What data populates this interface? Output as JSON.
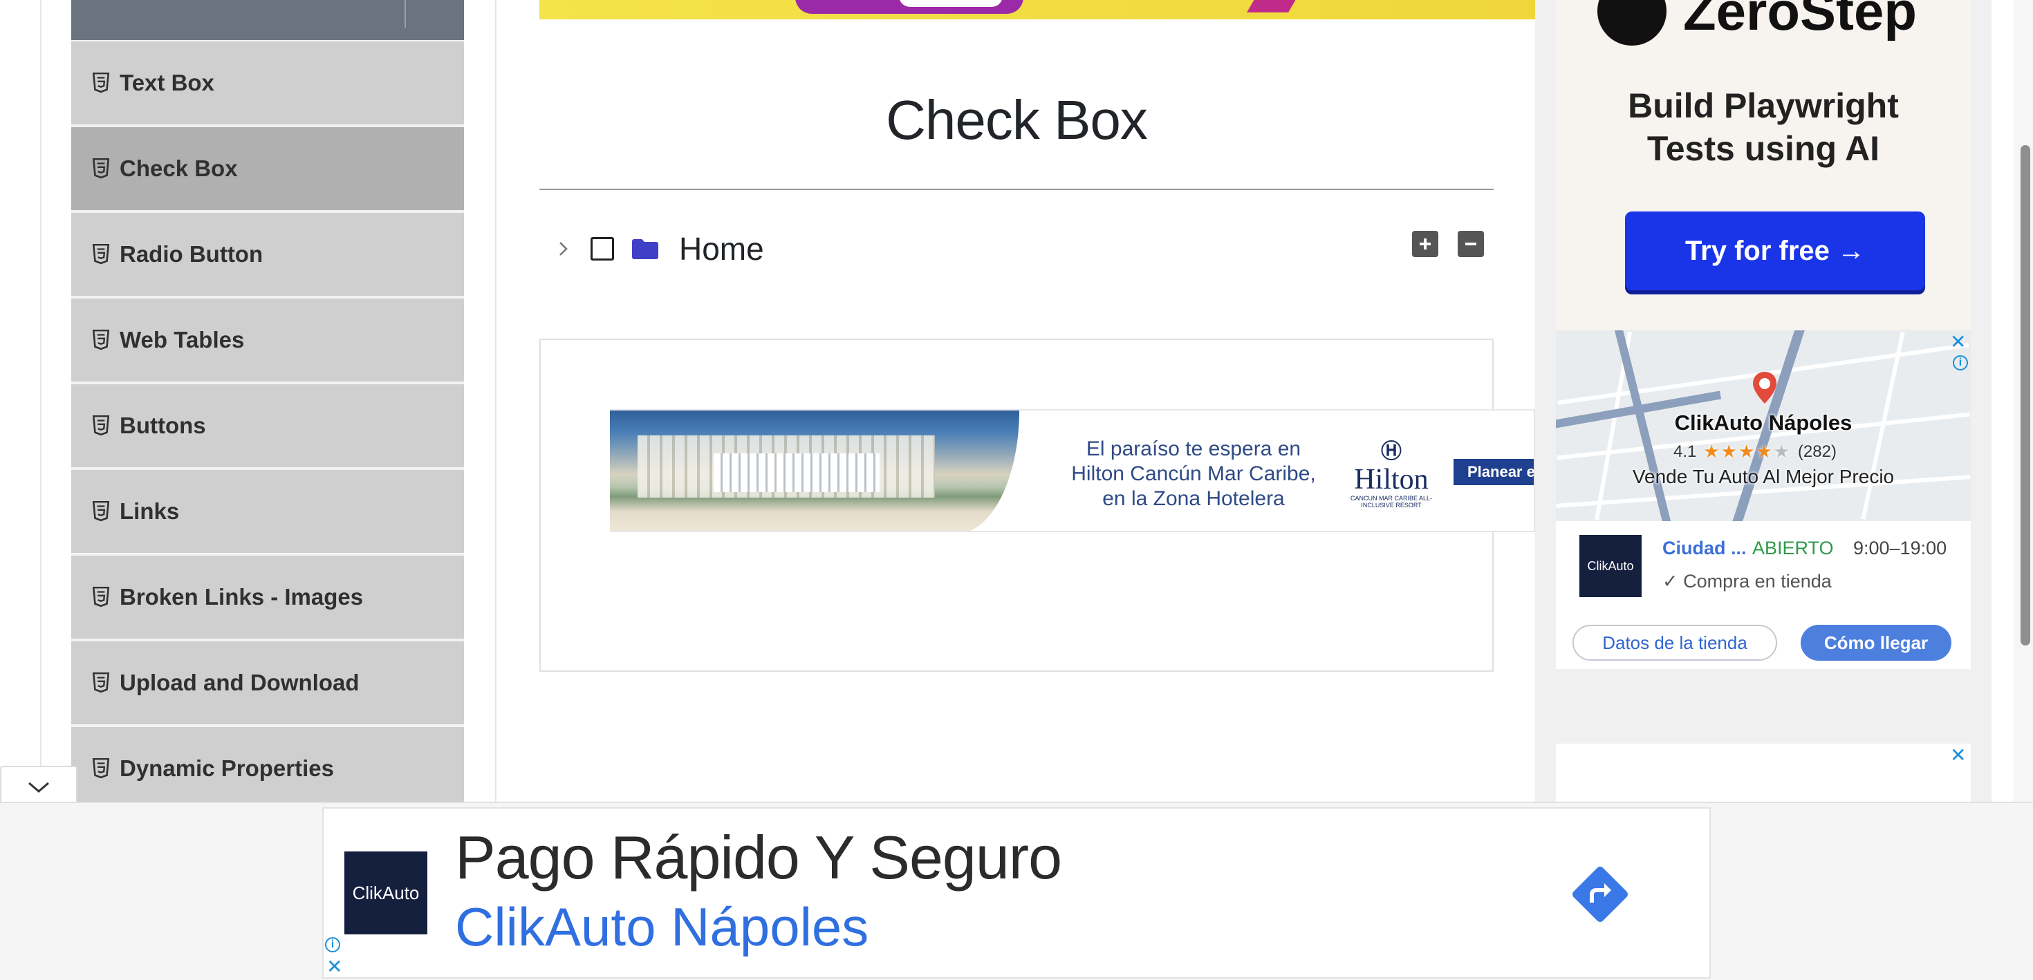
{
  "sidebar": {
    "items": [
      {
        "label": "Text Box",
        "active": false
      },
      {
        "label": "Check Box",
        "active": true
      },
      {
        "label": "Radio Button",
        "active": false
      },
      {
        "label": "Web Tables",
        "active": false
      },
      {
        "label": "Buttons",
        "active": false
      },
      {
        "label": "Links",
        "active": false
      },
      {
        "label": "Broken Links - Images",
        "active": false
      },
      {
        "label": "Upload and Download",
        "active": false
      },
      {
        "label": "Dynamic Properties",
        "active": false
      }
    ],
    "item_icon": "html5-icon",
    "collapse_icon": "chevron-down-icon"
  },
  "main": {
    "title": "Check Box",
    "tree": {
      "root_label": "Home",
      "expanded": false,
      "checked": false,
      "expand_all_icon": "plus-icon",
      "collapse_all_icon": "minus-icon"
    },
    "inline_ad": {
      "copy_line1": "El paraíso te espera en",
      "copy_line2": "Hilton Cancún Mar Caribe,",
      "copy_line3": "en la Zona Hotelera",
      "logo_text": "Hilton",
      "logo_subtitle": "CANCUN MAR CARIBE ALL-INCLUSIVE RESORT",
      "cta_label": "Planear e"
    }
  },
  "right_rail": {
    "zerostep": {
      "brand": "ZeroStep",
      "headline_line1": "Build Playwright",
      "headline_line2": "Tests using AI",
      "cta_label": "Try for free →"
    },
    "map_ad": {
      "business_name": "ClikAuto Nápoles",
      "rating": "4.1",
      "review_count": "(282)",
      "stars_filled": 4,
      "tagline": "Vende Tu Auto Al Mejor Precio",
      "thumb_label": "ClikAuto",
      "city": "Ciudad ...",
      "status": "ABIERTO",
      "hours": "9:00–19:00",
      "pickup": "Compra en tienda",
      "store_button": "Datos de la tienda",
      "directions_button": "Cómo llegar"
    }
  },
  "bottom_ad": {
    "thumb_label": "ClikAuto",
    "headline": "Pago Rápido Y Seguro",
    "subline": "ClikAuto Nápoles"
  },
  "colors": {
    "sidebar_item_bg": "#cfcfcf",
    "sidebar_active_bg": "#b0b0b0",
    "folder": "#3f3fc8",
    "zerostep_cta": "#1a35e8",
    "ad_link": "#2f6fe0",
    "open_status": "#2e9a48"
  }
}
